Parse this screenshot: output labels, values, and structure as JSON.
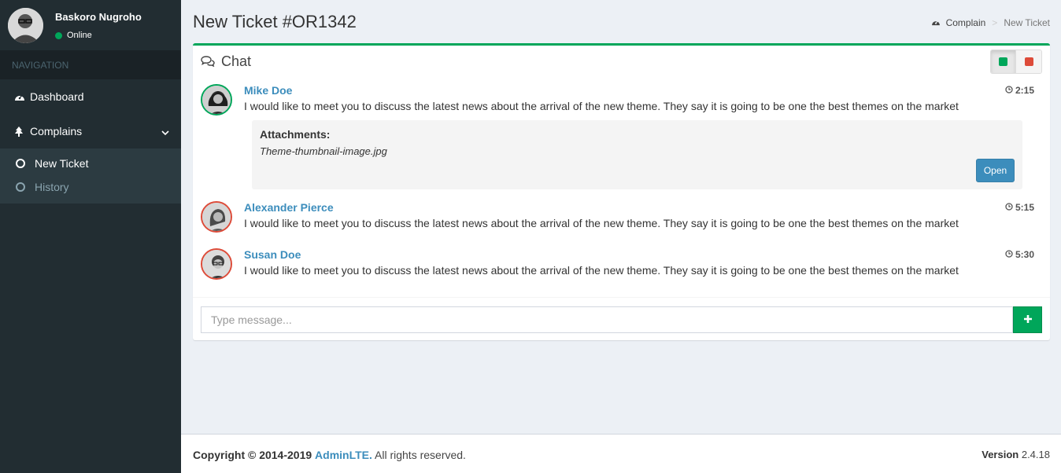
{
  "user": {
    "name": "Baskoro Nugroho",
    "status": "Online"
  },
  "nav": {
    "header": "NAVIGATION",
    "dashboard": "Dashboard",
    "complains": "Complains",
    "sub": [
      {
        "label": "New Ticket",
        "active": true
      },
      {
        "label": "History",
        "active": false
      }
    ]
  },
  "page": {
    "title": "New Ticket #OR1342"
  },
  "breadcrumb": {
    "root": "Complain",
    "current": "New Ticket"
  },
  "chat": {
    "title": "Chat",
    "messages": [
      {
        "name": "Mike Doe",
        "time": "2:15",
        "text": "I would like to meet you to discuss the latest news about the arrival of the new theme. They say it is going to be one the best themes on the market",
        "status": "online"
      },
      {
        "name": "Alexander Pierce",
        "time": "5:15",
        "text": "I would like to meet you to discuss the latest news about the arrival of the new theme. They say it is going to be one the best themes on the market",
        "status": "offline"
      },
      {
        "name": "Susan Doe",
        "time": "5:30",
        "text": "I would like to meet you to discuss the latest news about the arrival of the new theme. They say it is going to be one the best themes on the market",
        "status": "offline"
      }
    ],
    "attachment": {
      "heading": "Attachments:",
      "file": "Theme-thumbnail-image.jpg",
      "button": "Open"
    },
    "input_placeholder": "Type message..."
  },
  "footer": {
    "copyright": "Copyright © 2014-2019",
    "brand": "AdminLTE.",
    "rights": "All rights reserved.",
    "version_label": "Version",
    "version": "2.4.18"
  },
  "colors": {
    "success": "#00a65a",
    "danger": "#dd4b39",
    "primary": "#3c8dbc",
    "sidebar": "#222d32"
  },
  "icons": [
    "user-avatar",
    "dashboard-icon",
    "tree-icon",
    "chevron-down-icon",
    "circle-icon",
    "chat-icon",
    "clock-icon",
    "plus-icon"
  ]
}
